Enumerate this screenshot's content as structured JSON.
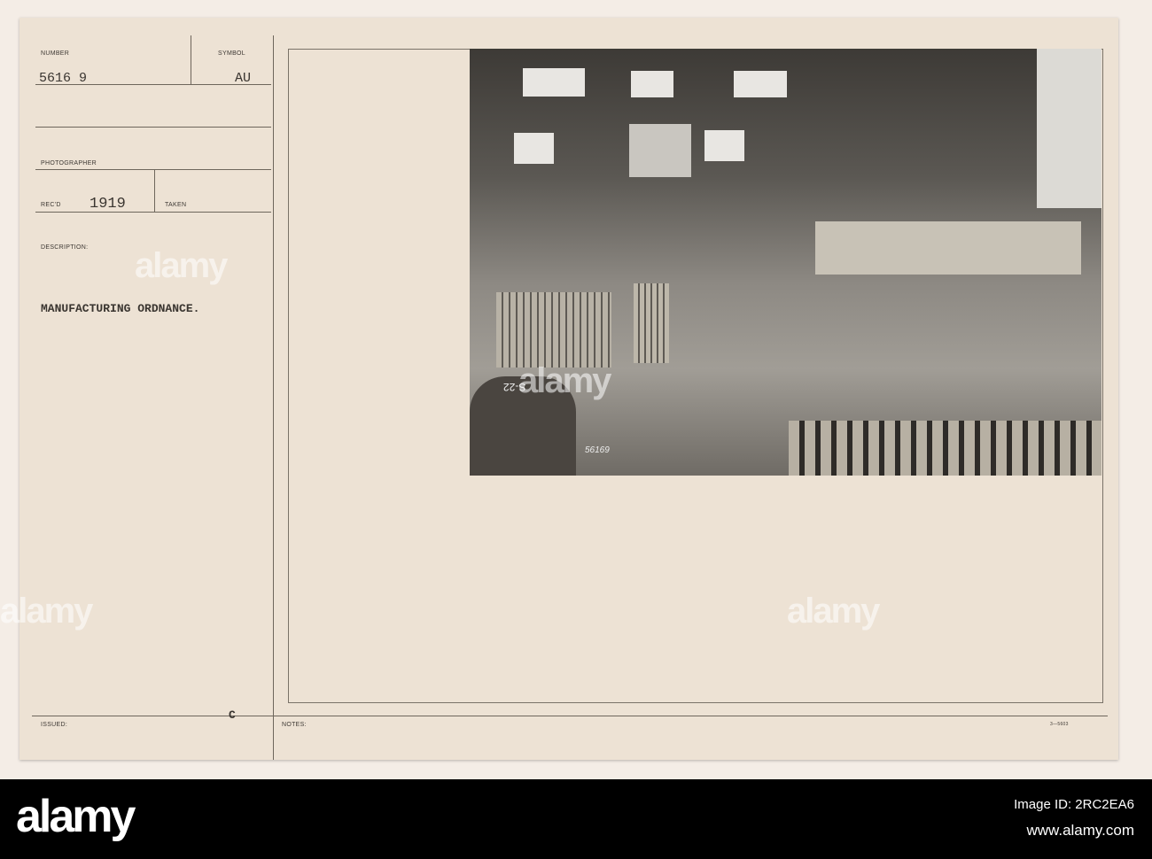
{
  "card": {
    "number_label": "NUMBER",
    "number_value": "5616 9",
    "symbol_label": "SYMBOL",
    "symbol_value": "AU",
    "photographer_label": "PHOTOGRAPHER",
    "recd_label": "REC'D",
    "recd_value": "1919",
    "taken_label": "TAKEN",
    "description_label": "DESCRIPTION:",
    "description_value": "MANUFACTURING ORDNANCE.",
    "issued_label": "ISSUED:",
    "issued_mark": "C",
    "notes_label": "NOTES:",
    "form_number": "3—5603"
  },
  "photo": {
    "barrel_mark": "S-22",
    "negative_number": "56169"
  },
  "watermark": {
    "text": "alamy"
  },
  "footer": {
    "logo": "alamy",
    "image_id": "Image ID: 2RC2EA6",
    "url": "www.alamy.com"
  }
}
